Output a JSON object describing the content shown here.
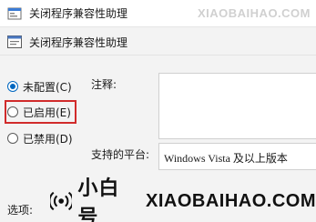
{
  "window": {
    "title": "关闭程序兼容性助理"
  },
  "header": {
    "policy_name": "关闭程序兼容性助理"
  },
  "options": [
    {
      "label": "未配置(C)",
      "checked": true
    },
    {
      "label": "已启用(E)",
      "checked": false,
      "highlighted": true
    },
    {
      "label": "已禁用(D)",
      "checked": false
    }
  ],
  "labels": {
    "comment": "注释:",
    "supported_on": "支持的平台:",
    "options": "选项:"
  },
  "fields": {
    "comment_value": "",
    "supported_on_value": "Windows Vista 及以上版本"
  },
  "watermark": {
    "top_text": "XIAOBAIHAO.COM",
    "brand_cn": "小白号",
    "brand_en": "XIAOBAIHAO.COM"
  },
  "colors": {
    "accent": "#0067c0",
    "highlight": "#d12b2b"
  }
}
